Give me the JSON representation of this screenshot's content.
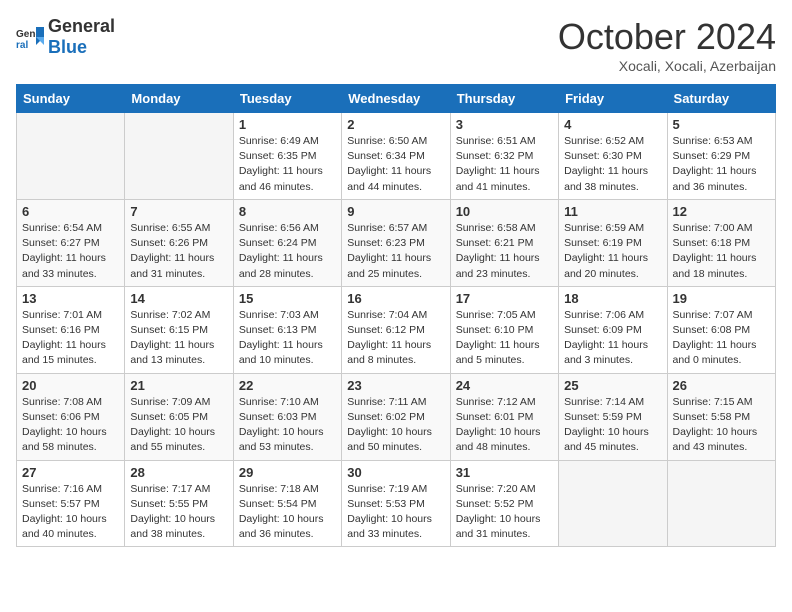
{
  "header": {
    "logo_general": "General",
    "logo_blue": "Blue",
    "month_title": "October 2024",
    "location": "Xocali, Xocali, Azerbaijan"
  },
  "weekdays": [
    "Sunday",
    "Monday",
    "Tuesday",
    "Wednesday",
    "Thursday",
    "Friday",
    "Saturday"
  ],
  "weeks": [
    [
      {
        "day": "",
        "info": ""
      },
      {
        "day": "",
        "info": ""
      },
      {
        "day": "1",
        "info": "Sunrise: 6:49 AM\nSunset: 6:35 PM\nDaylight: 11 hours and 46 minutes."
      },
      {
        "day": "2",
        "info": "Sunrise: 6:50 AM\nSunset: 6:34 PM\nDaylight: 11 hours and 44 minutes."
      },
      {
        "day": "3",
        "info": "Sunrise: 6:51 AM\nSunset: 6:32 PM\nDaylight: 11 hours and 41 minutes."
      },
      {
        "day": "4",
        "info": "Sunrise: 6:52 AM\nSunset: 6:30 PM\nDaylight: 11 hours and 38 minutes."
      },
      {
        "day": "5",
        "info": "Sunrise: 6:53 AM\nSunset: 6:29 PM\nDaylight: 11 hours and 36 minutes."
      }
    ],
    [
      {
        "day": "6",
        "info": "Sunrise: 6:54 AM\nSunset: 6:27 PM\nDaylight: 11 hours and 33 minutes."
      },
      {
        "day": "7",
        "info": "Sunrise: 6:55 AM\nSunset: 6:26 PM\nDaylight: 11 hours and 31 minutes."
      },
      {
        "day": "8",
        "info": "Sunrise: 6:56 AM\nSunset: 6:24 PM\nDaylight: 11 hours and 28 minutes."
      },
      {
        "day": "9",
        "info": "Sunrise: 6:57 AM\nSunset: 6:23 PM\nDaylight: 11 hours and 25 minutes."
      },
      {
        "day": "10",
        "info": "Sunrise: 6:58 AM\nSunset: 6:21 PM\nDaylight: 11 hours and 23 minutes."
      },
      {
        "day": "11",
        "info": "Sunrise: 6:59 AM\nSunset: 6:19 PM\nDaylight: 11 hours and 20 minutes."
      },
      {
        "day": "12",
        "info": "Sunrise: 7:00 AM\nSunset: 6:18 PM\nDaylight: 11 hours and 18 minutes."
      }
    ],
    [
      {
        "day": "13",
        "info": "Sunrise: 7:01 AM\nSunset: 6:16 PM\nDaylight: 11 hours and 15 minutes."
      },
      {
        "day": "14",
        "info": "Sunrise: 7:02 AM\nSunset: 6:15 PM\nDaylight: 11 hours and 13 minutes."
      },
      {
        "day": "15",
        "info": "Sunrise: 7:03 AM\nSunset: 6:13 PM\nDaylight: 11 hours and 10 minutes."
      },
      {
        "day": "16",
        "info": "Sunrise: 7:04 AM\nSunset: 6:12 PM\nDaylight: 11 hours and 8 minutes."
      },
      {
        "day": "17",
        "info": "Sunrise: 7:05 AM\nSunset: 6:10 PM\nDaylight: 11 hours and 5 minutes."
      },
      {
        "day": "18",
        "info": "Sunrise: 7:06 AM\nSunset: 6:09 PM\nDaylight: 11 hours and 3 minutes."
      },
      {
        "day": "19",
        "info": "Sunrise: 7:07 AM\nSunset: 6:08 PM\nDaylight: 11 hours and 0 minutes."
      }
    ],
    [
      {
        "day": "20",
        "info": "Sunrise: 7:08 AM\nSunset: 6:06 PM\nDaylight: 10 hours and 58 minutes."
      },
      {
        "day": "21",
        "info": "Sunrise: 7:09 AM\nSunset: 6:05 PM\nDaylight: 10 hours and 55 minutes."
      },
      {
        "day": "22",
        "info": "Sunrise: 7:10 AM\nSunset: 6:03 PM\nDaylight: 10 hours and 53 minutes."
      },
      {
        "day": "23",
        "info": "Sunrise: 7:11 AM\nSunset: 6:02 PM\nDaylight: 10 hours and 50 minutes."
      },
      {
        "day": "24",
        "info": "Sunrise: 7:12 AM\nSunset: 6:01 PM\nDaylight: 10 hours and 48 minutes."
      },
      {
        "day": "25",
        "info": "Sunrise: 7:14 AM\nSunset: 5:59 PM\nDaylight: 10 hours and 45 minutes."
      },
      {
        "day": "26",
        "info": "Sunrise: 7:15 AM\nSunset: 5:58 PM\nDaylight: 10 hours and 43 minutes."
      }
    ],
    [
      {
        "day": "27",
        "info": "Sunrise: 7:16 AM\nSunset: 5:57 PM\nDaylight: 10 hours and 40 minutes."
      },
      {
        "day": "28",
        "info": "Sunrise: 7:17 AM\nSunset: 5:55 PM\nDaylight: 10 hours and 38 minutes."
      },
      {
        "day": "29",
        "info": "Sunrise: 7:18 AM\nSunset: 5:54 PM\nDaylight: 10 hours and 36 minutes."
      },
      {
        "day": "30",
        "info": "Sunrise: 7:19 AM\nSunset: 5:53 PM\nDaylight: 10 hours and 33 minutes."
      },
      {
        "day": "31",
        "info": "Sunrise: 7:20 AM\nSunset: 5:52 PM\nDaylight: 10 hours and 31 minutes."
      },
      {
        "day": "",
        "info": ""
      },
      {
        "day": "",
        "info": ""
      }
    ]
  ]
}
